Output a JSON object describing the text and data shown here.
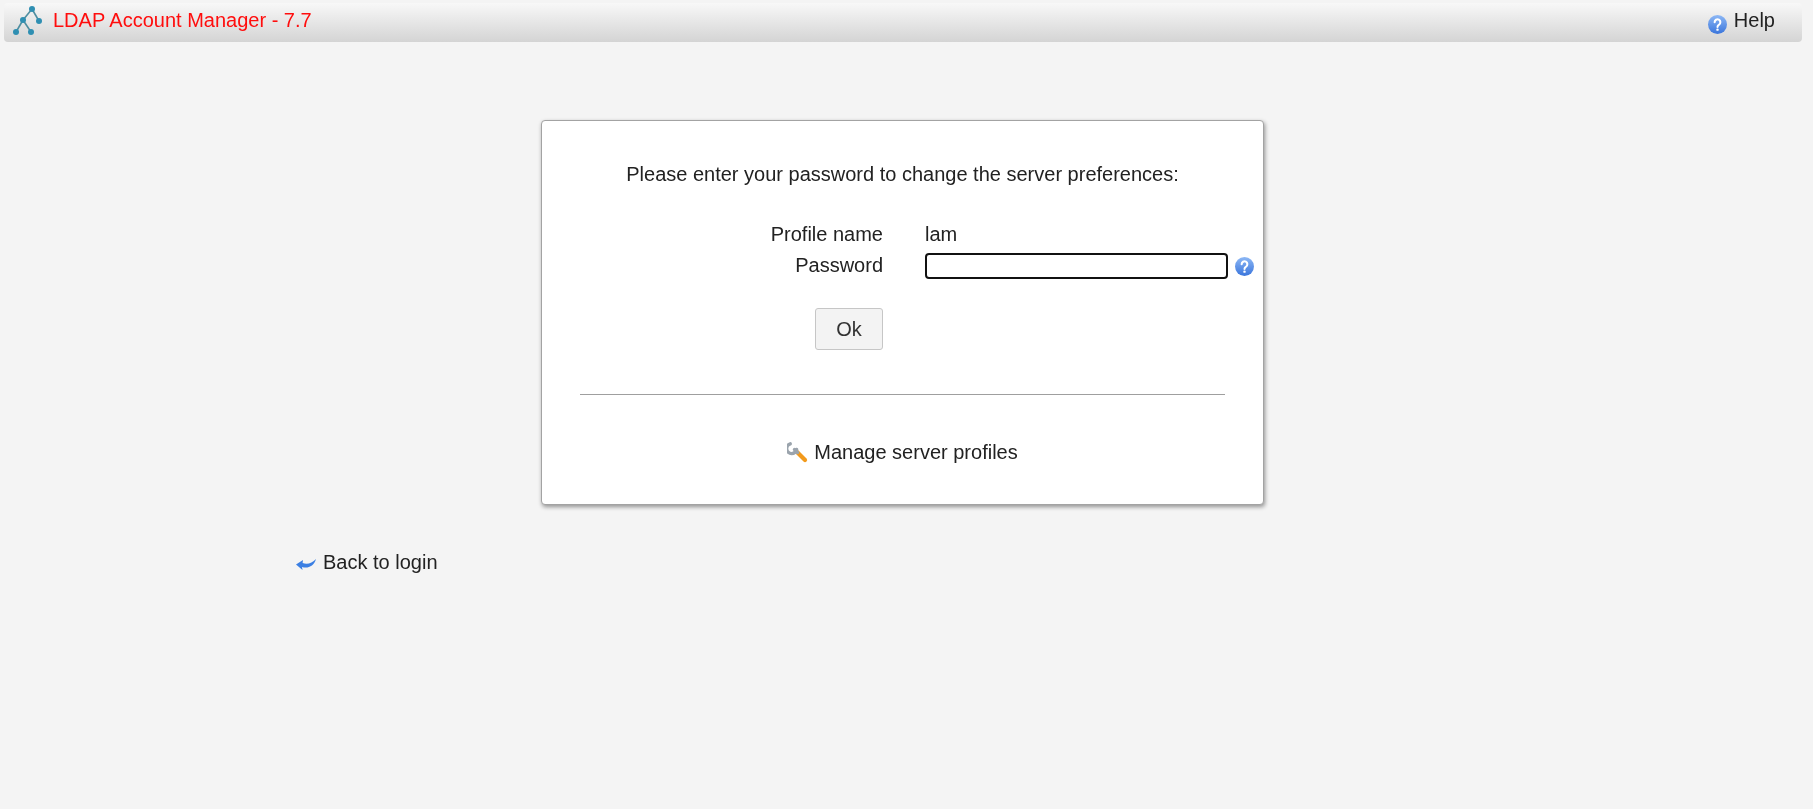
{
  "header": {
    "title": "LDAP Account Manager - 7.7",
    "help_link": "Help"
  },
  "dialog": {
    "intro": "Please enter your password to change the server preferences:",
    "fields": [
      {
        "kind": "text",
        "label": "Profile name",
        "value": "lam"
      },
      {
        "kind": "input",
        "label": "Password",
        "focused": true
      }
    ],
    "buttons": [
      "Ok"
    ],
    "link": "Manage server profiles"
  },
  "back_link": "Back to login"
}
